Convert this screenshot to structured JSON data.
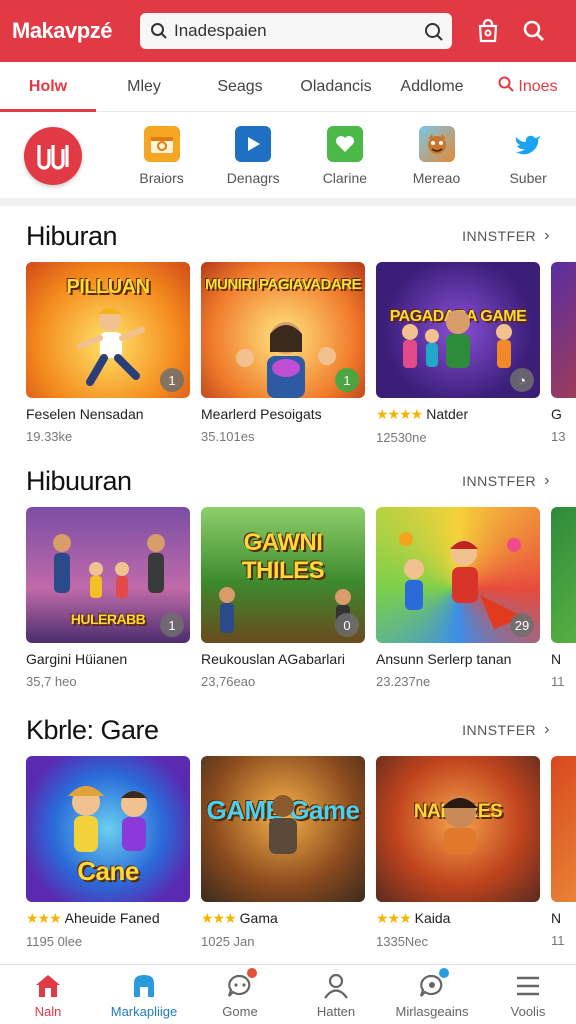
{
  "header": {
    "brand": "Makavpzé",
    "search_text": "Inadespaien",
    "search_icon": "search-icon",
    "icons": [
      "shopping-bag-icon",
      "search-icon"
    ],
    "color": "#e23a45"
  },
  "tabs": [
    {
      "label": "Holw",
      "state": "active"
    },
    {
      "label": "Mley"
    },
    {
      "label": "Seags"
    },
    {
      "label": "Oladancis"
    },
    {
      "label": "Addlome"
    },
    {
      "label": "Inoes",
      "icon": "search-icon"
    }
  ],
  "categories": [
    {
      "label": "Braiors",
      "icon": "camera-app-icon",
      "color": "#f5a623"
    },
    {
      "label": "Denagrs",
      "icon": "play-icon",
      "color": "#1f6fc5"
    },
    {
      "label": "Clarine",
      "icon": "heart-icon",
      "color": "#4cb848"
    },
    {
      "label": "Mereao",
      "icon": "cartoon-character-icon",
      "color": "#e08a35"
    },
    {
      "label": "Suber",
      "icon": "bird-icon",
      "color": "#1da1f2"
    }
  ],
  "sections": [
    {
      "title": "Hiburan",
      "more": "INNSTFER",
      "cards": [
        {
          "art_text": "PILLUAN",
          "badge": "1",
          "name": "Feselen Nensadan",
          "meta": "19.33ke",
          "stars": ""
        },
        {
          "art_text": "MUNIRI PAGIAVADARE",
          "badge": "1",
          "name": "Mearlerd Pesoigats",
          "meta": "35.101es",
          "stars": ""
        },
        {
          "art_text": "PAGADARA GAME",
          "badge": "",
          "name": "Natder",
          "meta": "12530ne",
          "stars": "★★★★"
        },
        {
          "art_text": "",
          "badge": "",
          "name": "G",
          "meta": "13",
          "stars": ""
        }
      ]
    },
    {
      "title": "Hibuuran",
      "more": "INNSTFER",
      "cards": [
        {
          "art_text": "HULERABB",
          "badge": "1",
          "name": "Gargini Hüianen",
          "meta": "35,7 heo",
          "stars": ""
        },
        {
          "art_text": "GAWNI THILES",
          "badge": "0",
          "name": "Reukouslan AGabarlari",
          "meta": "23,76eao",
          "stars": ""
        },
        {
          "art_text": "",
          "badge": "29",
          "name": "Ansunn Serlerp tanan",
          "meta": "23.237ne",
          "stars": ""
        },
        {
          "art_text": "",
          "badge": "",
          "name": "N",
          "meta": "11",
          "stars": ""
        }
      ]
    },
    {
      "title": "Kbrle: Gare",
      "more": "INNSTFER",
      "cards": [
        {
          "art_text": "Cane",
          "badge": "",
          "name": "Aheuide Faned",
          "meta": "1195 0lee",
          "stars": "★★★"
        },
        {
          "art_text": "GAME Game",
          "badge": "",
          "name": "Gama",
          "meta": "1025 Jan",
          "stars": "★★★"
        },
        {
          "art_text": "NALURES MEABMI",
          "badge": "",
          "name": "Kaida",
          "meta": "1335Nec",
          "stars": "★★★"
        },
        {
          "art_text": "",
          "badge": "",
          "name": "N",
          "meta": "11",
          "stars": ""
        }
      ]
    }
  ],
  "bottom_nav": [
    {
      "label": "Naln",
      "icon": "home-icon",
      "state": "active"
    },
    {
      "label": "Markapliige",
      "icon": "store-icon",
      "state": "selected"
    },
    {
      "label": "Gome",
      "icon": "game-chat-icon"
    },
    {
      "label": "Hatten",
      "icon": "person-icon"
    },
    {
      "label": "Mirlasgeains",
      "icon": "message-icon"
    },
    {
      "label": "Voolis",
      "icon": "menu-icon"
    }
  ]
}
